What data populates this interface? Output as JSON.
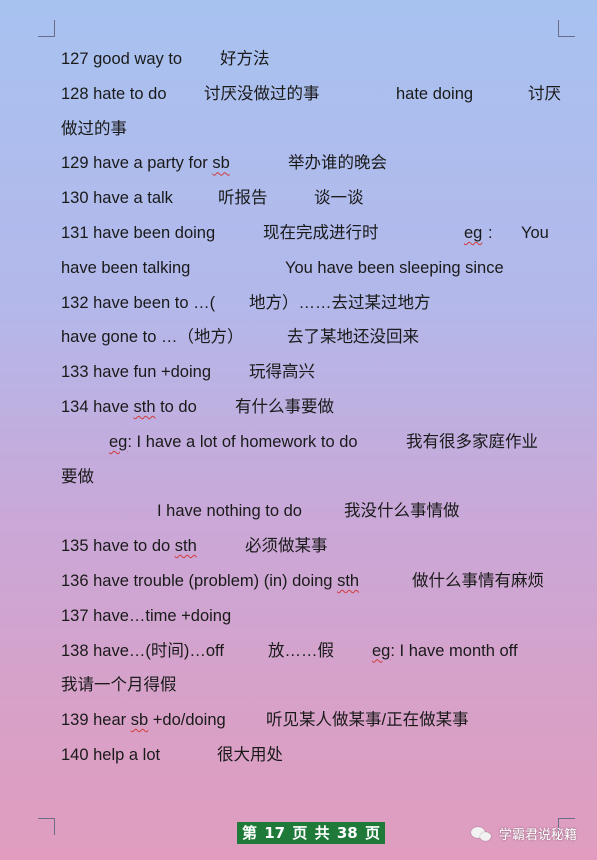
{
  "lines": [
    {
      "segments": [
        "127 good way to",
        "好方法"
      ]
    },
    {
      "segments": [
        "128 hate to do",
        "讨厌没做过的事",
        "hate doing",
        "讨厌"
      ]
    },
    {
      "segments": [
        "做过的事"
      ]
    },
    {
      "segments": [
        "129 have a party for ",
        "sb",
        "举办谁的晚会"
      ]
    },
    {
      "segments": [
        "130 have a talk",
        "听报告",
        "谈一谈"
      ]
    },
    {
      "segments": [
        "131 have been doing",
        "现在完成进行时",
        "eg",
        ":",
        "You"
      ]
    },
    {
      "segments": [
        "have been talking",
        "You have been sleeping since"
      ]
    },
    {
      "segments": [
        "132 have been to …(",
        "地方）……去过某过地方"
      ]
    },
    {
      "segments": [
        "have gone to …（地方）",
        "去了某地还没回来"
      ]
    },
    {
      "segments": [
        "133 have fun +doing",
        "玩得高兴"
      ]
    },
    {
      "segments": [
        "134 have ",
        "sth",
        " to do",
        "有什么事要做"
      ]
    },
    {
      "segments": [
        "eg",
        ": I have a lot of homework to do",
        "我有很多家庭作业"
      ]
    },
    {
      "segments": [
        "要做"
      ]
    },
    {
      "segments": [
        "I have nothing to do",
        "我没什么事情做"
      ]
    },
    {
      "segments": [
        "135 have to do ",
        "sth",
        "必须做某事"
      ]
    },
    {
      "segments": [
        "136 have trouble (problem) (in) doing ",
        "sth",
        "做什么事情有麻烦"
      ]
    },
    {
      "segments": [
        "137 have…time +doing"
      ]
    },
    {
      "segments": [
        "138 have…(时间)…off",
        "放……假",
        "eg",
        ": I have month off"
      ]
    },
    {
      "segments": [
        "我请一个月得假"
      ]
    },
    {
      "segments": [
        "139 hear ",
        "sb",
        " +do/doing",
        "听见某人做某事/正在做某事"
      ]
    },
    {
      "segments": [
        "140 help a lot",
        "很大用处"
      ]
    }
  ],
  "footer": {
    "page_label_1": "第",
    "page_current": "17",
    "page_label_2": "页",
    "page_label_3": "共",
    "page_total": "38",
    "page_label_4": "页"
  },
  "watermark": {
    "text": "学霸君说秘籍",
    "icon": "wechat-icon"
  },
  "colors": {
    "background_top": "#a8c2f0",
    "background_bottom": "#e09dbf",
    "footer_bg": "#1f7a3a",
    "squiggle": "#d23a3a"
  }
}
